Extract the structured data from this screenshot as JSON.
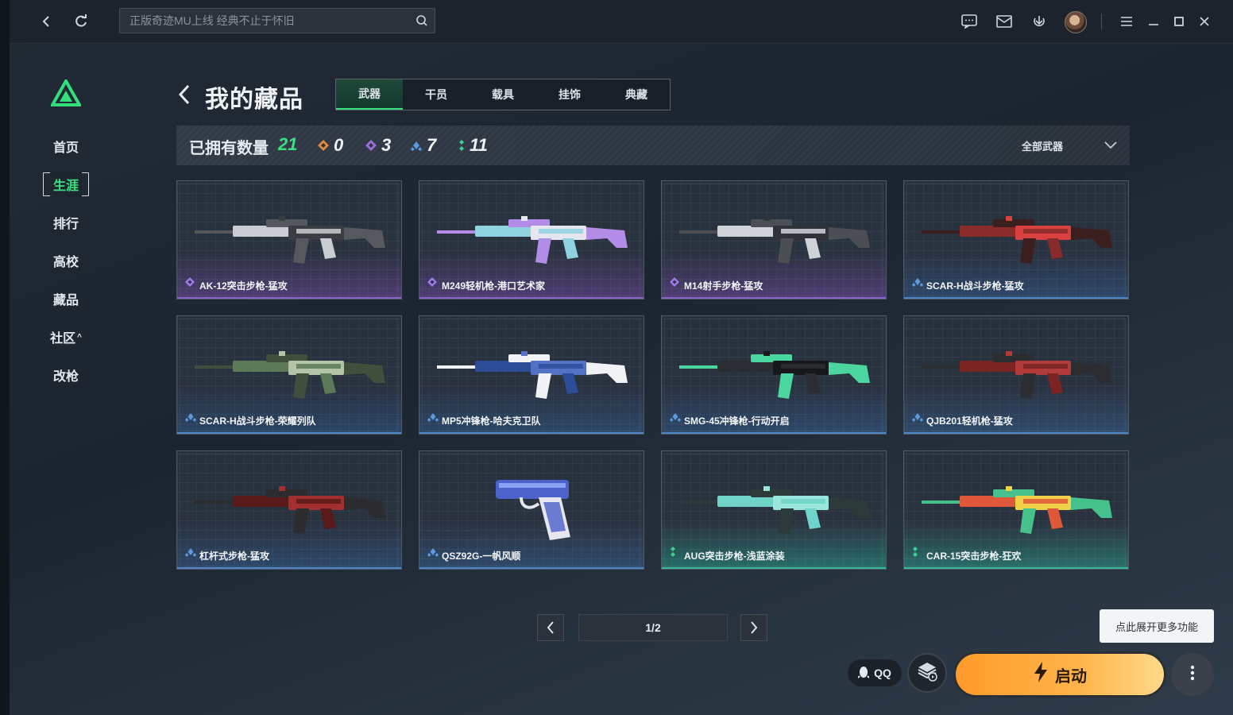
{
  "topbar": {
    "search_placeholder": "正版奇迹MU上线 经典不止于怀旧",
    "icons": [
      "back-icon",
      "refresh-icon",
      "search-icon",
      "chat-icon",
      "mail-icon",
      "download-icon",
      "menu-icon",
      "minimize-icon",
      "maximize-icon",
      "close-icon"
    ]
  },
  "sidebar": {
    "items": [
      {
        "label": "首页"
      },
      {
        "label": "生涯",
        "active": true
      },
      {
        "label": "排行"
      },
      {
        "label": "高校"
      },
      {
        "label": "藏品"
      },
      {
        "label": "社区",
        "caret": "^"
      },
      {
        "label": "改枪"
      }
    ]
  },
  "header": {
    "title": "我的藏品",
    "tabs": [
      "武器",
      "干员",
      "载具",
      "挂饰",
      "典藏"
    ],
    "active_tab": "武器"
  },
  "stats": {
    "label": "已拥有数量",
    "total": "21",
    "rarity_counts": [
      {
        "tier": "orange",
        "value": "0",
        "color": "#e08a3c"
      },
      {
        "tier": "purple",
        "value": "3",
        "color": "#9b6ee0"
      },
      {
        "tier": "blue",
        "value": "7",
        "color": "#5b9ae0"
      },
      {
        "tier": "green",
        "value": "11",
        "color": "#3ccf8e"
      }
    ],
    "filter_label": "全部武器"
  },
  "items": [
    {
      "name": "AK-12突击步枪-猛攻",
      "tier": "purple"
    },
    {
      "name": "M249轻机枪-港口艺术家",
      "tier": "purple"
    },
    {
      "name": "M14射手步枪-猛攻",
      "tier": "purple"
    },
    {
      "name": "SCAR-H战斗步枪-猛攻",
      "tier": "blue"
    },
    {
      "name": "SCAR-H战斗步枪-荣耀列队",
      "tier": "blue"
    },
    {
      "name": "MP5冲锋枪-哈夫克卫队",
      "tier": "blue"
    },
    {
      "name": "SMG-45冲锋枪-行动开启",
      "tier": "blue"
    },
    {
      "name": "QJB201轻机枪-猛攻",
      "tier": "blue"
    },
    {
      "name": "杠杆式步枪-猛攻",
      "tier": "blue"
    },
    {
      "name": "QSZ92G-一帆风顺",
      "tier": "blue"
    },
    {
      "name": "AUG突击步枪-浅蓝涂装",
      "tier": "teal"
    },
    {
      "name": "CAR-15突击步枪-狂欢",
      "tier": "teal"
    }
  ],
  "pager": {
    "label": "1/2"
  },
  "bottom": {
    "tooltip": "点此展开更多功能",
    "qq_label": "QQ",
    "launch_label": "启动"
  },
  "colors": {
    "accent": "#37e27f",
    "launch": "#ffb54b"
  }
}
